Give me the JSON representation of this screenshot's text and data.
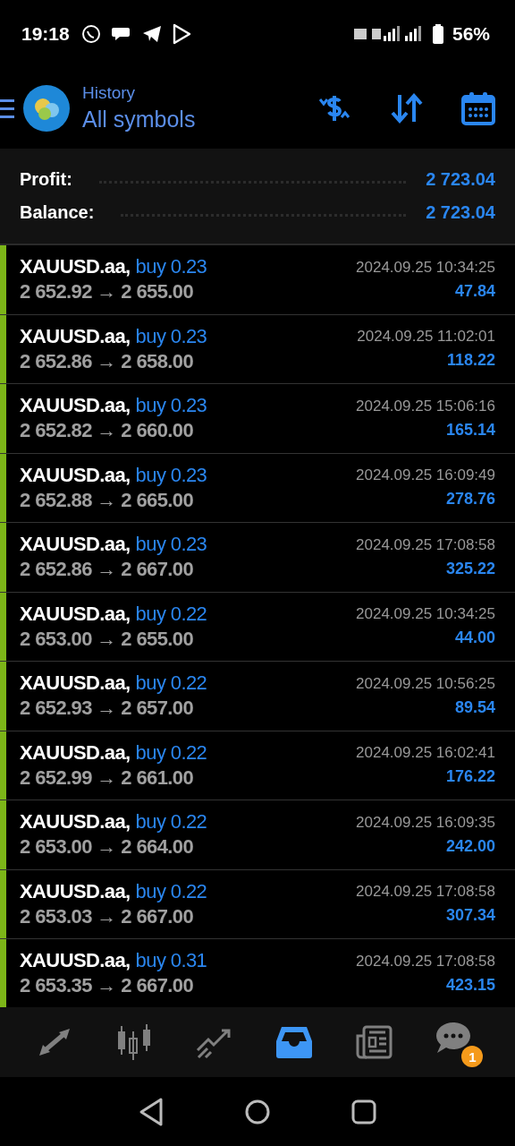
{
  "status_bar": {
    "time": "19:18",
    "battery": "56%"
  },
  "header": {
    "title": "History",
    "subtitle": "All symbols"
  },
  "summary": [
    {
      "label": "Profit:",
      "value": "2 723.04"
    },
    {
      "label": "Balance:",
      "value": "2 723.04"
    }
  ],
  "deals": [
    {
      "kind": "buy",
      "symbol": "XAUUSD.aa,",
      "deal": "buy 0.23",
      "prices": "2 652.92 → 2 655.00",
      "time": "2024.09.25 10:34:25",
      "profit": "47.84"
    },
    {
      "kind": "buy",
      "symbol": "XAUUSD.aa,",
      "deal": "buy 0.23",
      "prices": "2 652.86 → 2 658.00",
      "time": "2024.09.25 11:02:01",
      "profit": "118.22"
    },
    {
      "kind": "buy",
      "symbol": "XAUUSD.aa,",
      "deal": "buy 0.23",
      "prices": "2 652.82 → 2 660.00",
      "time": "2024.09.25 15:06:16",
      "profit": "165.14"
    },
    {
      "kind": "buy",
      "symbol": "XAUUSD.aa,",
      "deal": "buy 0.23",
      "prices": "2 652.88 → 2 665.00",
      "time": "2024.09.25 16:09:49",
      "profit": "278.76"
    },
    {
      "kind": "buy",
      "symbol": "XAUUSD.aa,",
      "deal": "buy 0.23",
      "prices": "2 652.86 → 2 667.00",
      "time": "2024.09.25 17:08:58",
      "profit": "325.22"
    },
    {
      "kind": "buy",
      "symbol": "XAUUSD.aa,",
      "deal": "buy 0.22",
      "prices": "2 653.00 → 2 655.00",
      "time": "2024.09.25 10:34:25",
      "profit": "44.00"
    },
    {
      "kind": "buy",
      "symbol": "XAUUSD.aa,",
      "deal": "buy 0.22",
      "prices": "2 652.93 → 2 657.00",
      "time": "2024.09.25 10:56:25",
      "profit": "89.54"
    },
    {
      "kind": "buy",
      "symbol": "XAUUSD.aa,",
      "deal": "buy 0.22",
      "prices": "2 652.99 → 2 661.00",
      "time": "2024.09.25 16:02:41",
      "profit": "176.22"
    },
    {
      "kind": "buy",
      "symbol": "XAUUSD.aa,",
      "deal": "buy 0.22",
      "prices": "2 653.00 → 2 664.00",
      "time": "2024.09.25 16:09:35",
      "profit": "242.00"
    },
    {
      "kind": "buy",
      "symbol": "XAUUSD.aa,",
      "deal": "buy 0.22",
      "prices": "2 653.03 → 2 667.00",
      "time": "2024.09.25 17:08:58",
      "profit": "307.34"
    },
    {
      "kind": "buy",
      "symbol": "XAUUSD.aa,",
      "deal": "buy 0.31",
      "prices": "2 653.35 → 2 667.00",
      "time": "2024.09.25 17:08:58",
      "profit": "423.15"
    }
  ],
  "tabs": [
    {
      "kind": "trade",
      "selected": false
    },
    {
      "kind": "quotes",
      "selected": false
    },
    {
      "kind": "chart",
      "selected": false
    },
    {
      "kind": "history",
      "selected": true
    },
    {
      "kind": "news",
      "selected": false
    },
    {
      "kind": "chat",
      "selected": false,
      "badge": "1"
    }
  ]
}
